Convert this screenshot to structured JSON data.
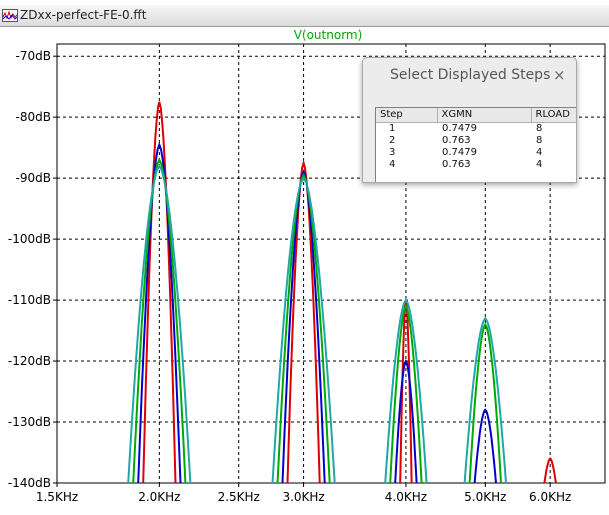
{
  "window": {
    "title": "ZDxx-perfect-FE-0.fft",
    "icon": "waveform-icon"
  },
  "plot": {
    "trace_title": "V(outnorm)"
  },
  "popup": {
    "title": "Select Displayed Steps",
    "close_glyph": "×",
    "columns": [
      "Step",
      "XGMN",
      "RLOAD"
    ],
    "rows": [
      {
        "step": "1",
        "xgmn": "0.7479",
        "rload": "8"
      },
      {
        "step": "2",
        "xgmn": "0.763",
        "rload": "8"
      },
      {
        "step": "3",
        "xgmn": "0.7479",
        "rload": "4"
      },
      {
        "step": "4",
        "xgmn": "0.763",
        "rload": "4"
      }
    ]
  },
  "chart_data": {
    "type": "line",
    "title": "V(outnorm)",
    "xscale": "log",
    "xlim": [
      1500,
      7000
    ],
    "ylim": [
      -140,
      -68
    ],
    "grid": true,
    "x_ticks": [
      {
        "value": 1500,
        "label": "1.5KHz"
      },
      {
        "value": 2000,
        "label": "2.0KHz"
      },
      {
        "value": 2500,
        "label": "2.5KHz"
      },
      {
        "value": 3000,
        "label": "3.0KHz"
      },
      {
        "value": 4000,
        "label": "4.0KHz"
      },
      {
        "value": 5000,
        "label": "5.0KHz"
      },
      {
        "value": 6000,
        "label": "6.0KHz"
      }
    ],
    "y_ticks": [
      {
        "value": -70,
        "label": "-70dB"
      },
      {
        "value": -80,
        "label": "-80dB"
      },
      {
        "value": -90,
        "label": "-90dB"
      },
      {
        "value": -100,
        "label": "-100dB"
      },
      {
        "value": -110,
        "label": "-110dB"
      },
      {
        "value": -120,
        "label": "-120dB"
      },
      {
        "value": -130,
        "label": "-130dB"
      },
      {
        "value": -140,
        "label": "-140dB"
      }
    ],
    "series": [
      {
        "color": "#dd0000",
        "peaks": [
          {
            "f": 2000,
            "db": -77.5
          },
          {
            "f": 3000,
            "db": -87.5
          },
          {
            "f": 4000,
            "db": -110
          },
          {
            "f": 6000,
            "db": -136
          }
        ]
      },
      {
        "color": "#0000cc",
        "peaks": [
          {
            "f": 2000,
            "db": -84.5
          },
          {
            "f": 3000,
            "db": -89
          },
          {
            "f": 4000,
            "db": -120
          },
          {
            "f": 5000,
            "db": -128
          }
        ]
      },
      {
        "color": "#00aa00",
        "peaks": [
          {
            "f": 2000,
            "db": -87
          },
          {
            "f": 3000,
            "db": -89.5
          },
          {
            "f": 4000,
            "db": -111
          },
          {
            "f": 5000,
            "db": -114
          }
        ]
      },
      {
        "color": "#20a8a8",
        "peaks": [
          {
            "f": 2000,
            "db": -88
          },
          {
            "f": 3000,
            "db": -90
          },
          {
            "f": 4000,
            "db": -110
          },
          {
            "f": 5000,
            "db": -113
          }
        ]
      }
    ]
  }
}
